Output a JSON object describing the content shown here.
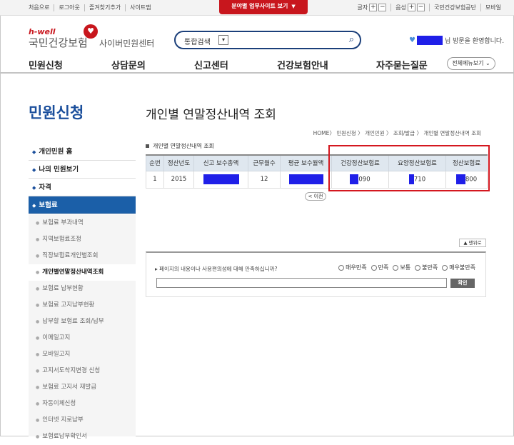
{
  "util": {
    "links": [
      "처음으로",
      "로그아웃",
      "즐겨찾기추가",
      "사이트맵"
    ],
    "red_tab": "분야별 업무사이트 보기",
    "font_label": "글자",
    "sound_label": "음성",
    "plus": "+",
    "minus": "−",
    "org_link": "국민건강보험공단",
    "mobile_link": "모바일"
  },
  "header": {
    "logo_small": "h-well",
    "logo_name": "국민건강보험",
    "center_name": "사이버민원센터",
    "search_label": "통합검색",
    "welcome_text": "님 방문을 환영합니다."
  },
  "gnb": {
    "items": [
      "민원신청",
      "상담문의",
      "신고센터",
      "건강보험안내",
      "자주묻는질문"
    ],
    "all_menu": "전체메뉴보기"
  },
  "left": {
    "title": "민원신청",
    "items": [
      "개인민원 홈",
      "나의 민원보기",
      "자격",
      "보험료"
    ],
    "sub1": [
      "보험료 부과내역",
      "지역보험료조정",
      "직장보험료개인별조회",
      "개인별연말정산내역조회"
    ],
    "sub2": [
      "보험료 납부현황",
      "보험료 고지납부현황",
      "납부할 보험료 조회/납부",
      "이메일고지",
      "모바일고지",
      "고지서도착지변경 신청",
      "보험료 고지서 재발급",
      "자동이체신청",
      "인터넷 지로납부",
      "보험료납부확인서"
    ]
  },
  "content": {
    "title": "개인별 연말정산내역 조회",
    "breadcrumb": "HOME〉 민원신청 〉 개인민원 〉 조회/발급 〉 개인별 연말정산내역 조회",
    "table_caption": "개인별 연말정산내역 조회",
    "headers": [
      "순번",
      "정산년도",
      "신고 보수총액",
      "근무월수",
      "평균 보수월액",
      "건강정산보험료",
      "요양정산보험료",
      "정산보험료"
    ],
    "row": {
      "no": "1",
      "year": "2015",
      "months": "12",
      "health": "090",
      "care": "710",
      "total": "800"
    },
    "prev_button": "< 이전",
    "top_button": "▲ 맨위로"
  },
  "survey": {
    "question": "페이지의 내용이나 사용편의성에 대해 만족하십니까?",
    "options": [
      "매우만족",
      "만족",
      "보통",
      "불만족",
      "매우불만족"
    ],
    "submit": "확인"
  },
  "colors": {
    "brand_red": "#c8161d",
    "nav_blue": "#1b5fa8",
    "redaction": "#1f1fe8",
    "highlight_box": "#d4171f"
  }
}
